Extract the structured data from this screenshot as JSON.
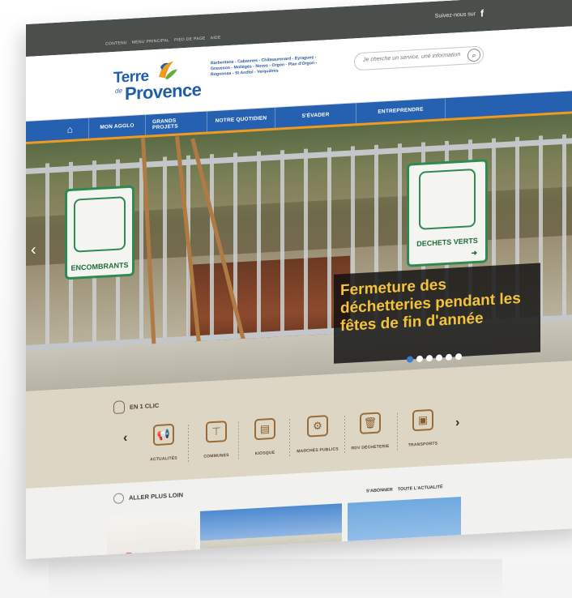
{
  "topbar": {
    "mini_links": [
      "CONTENU",
      "MENU PRINCIPAL",
      "PIED DE PAGE",
      "AIDE"
    ],
    "follow_label": "Suivez-nous sur",
    "facebook_icon": "f"
  },
  "header": {
    "logo_terre": "Terre",
    "logo_de": "de",
    "logo_provence": "Provence",
    "communes": "Barbentane - Cabannes - Châteaurenard - Eyragues - Graveson - Mollégès - Noves - Orgon - Plan d'Orgon - Rognonas - St Andiol - Verquières",
    "search_placeholder": "Je cherche un service, une information..."
  },
  "nav": {
    "home_icon": "⌂",
    "items": [
      "MON AGGLO",
      "GRANDS PROJETS",
      "NOTRE QUOTIDIEN",
      "S'ÉVADER",
      "ENTREPRENDRE"
    ]
  },
  "hero": {
    "caption": "Fermeture des déchetteries pendant les fêtes de fin d'année",
    "sign_left": "ENCOMBRANTS",
    "sign_right": "DECHETS VERTS",
    "sign_right_arrow": "➜",
    "prev_arrow": "‹",
    "slides_count": 6,
    "active_slide": 1
  },
  "clic": {
    "title": "EN 1 CLIC",
    "prev": "‹",
    "next": "›",
    "tiles": [
      {
        "label": "ACTUALITÉS",
        "icon": "megaphone-icon",
        "glyph": "📢"
      },
      {
        "label": "COMMUNES",
        "icon": "signpost-icon",
        "glyph": "⊤"
      },
      {
        "label": "KIOSQUE",
        "icon": "newspaper-icon",
        "glyph": "▤"
      },
      {
        "label": "MARCHÉS PUBLICS",
        "icon": "gear-icon",
        "glyph": "⚙"
      },
      {
        "label": "RDV DÉCHETERIE",
        "icon": "trash-icon",
        "glyph": "🗑"
      },
      {
        "label": "TRANSPORTS",
        "icon": "bus-icon",
        "glyph": "▣"
      }
    ]
  },
  "loin": {
    "title": "ALLER PLUS LOIN",
    "subscribe": "S'ABONNER",
    "all_news": "TOUTE L'ACTUALITÉ"
  },
  "colors": {
    "nav_blue": "#2561b0",
    "accent_orange": "#f29a1a",
    "caption_yellow": "#f5c33b",
    "sign_green": "#2f8a52"
  }
}
